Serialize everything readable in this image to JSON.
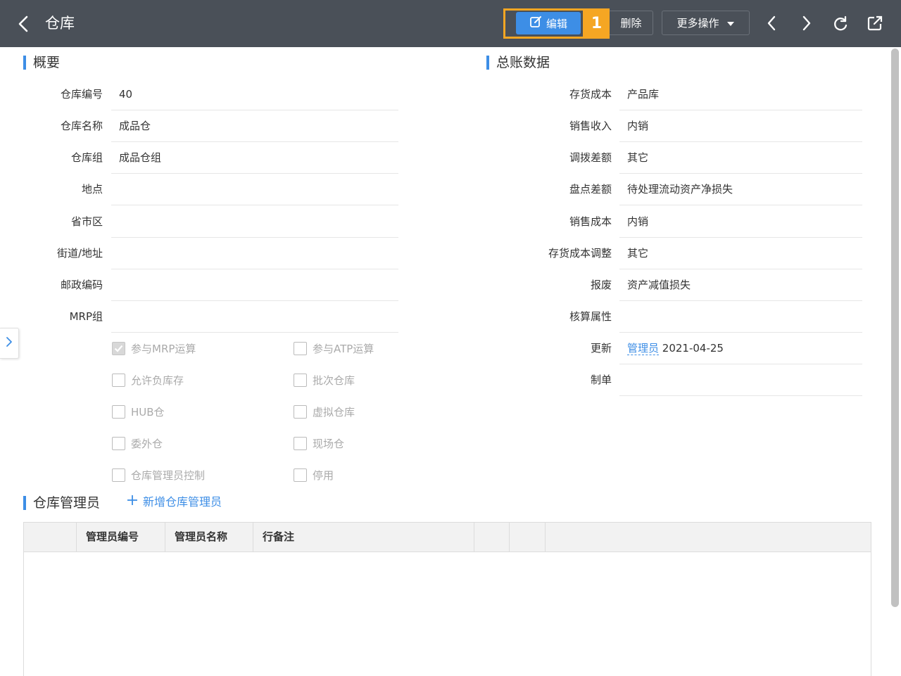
{
  "header": {
    "title": "仓库",
    "edit_label": "编辑",
    "marker": "1",
    "delete_label": "删除",
    "more_label": "更多操作"
  },
  "overview": {
    "title": "概要",
    "fields": [
      {
        "label": "仓库编号",
        "value": "40"
      },
      {
        "label": "仓库名称",
        "value": "成品仓"
      },
      {
        "label": "仓库组",
        "value": "成品仓组"
      },
      {
        "label": "地点",
        "value": ""
      },
      {
        "label": "省市区",
        "value": ""
      },
      {
        "label": "街道/地址",
        "value": ""
      },
      {
        "label": "邮政编码",
        "value": ""
      },
      {
        "label": "MRP组",
        "value": ""
      }
    ],
    "checkboxes": [
      {
        "label": "参与MRP运算",
        "checked": true
      },
      {
        "label": "参与ATP运算",
        "checked": false
      },
      {
        "label": "允许负库存",
        "checked": false
      },
      {
        "label": "批次仓库",
        "checked": false
      },
      {
        "label": "HUB仓",
        "checked": false
      },
      {
        "label": "虚拟仓库",
        "checked": false
      },
      {
        "label": "委外仓",
        "checked": false
      },
      {
        "label": "现场仓",
        "checked": false
      },
      {
        "label": "仓库管理员控制",
        "checked": false
      },
      {
        "label": "停用",
        "checked": false
      }
    ]
  },
  "ledger": {
    "title": "总账数据",
    "fields": [
      {
        "label": "存货成本",
        "value": "产品库"
      },
      {
        "label": "销售收入",
        "value": "内销"
      },
      {
        "label": "调拨差额",
        "value": "其它"
      },
      {
        "label": "盘点差额",
        "value": "待处理流动资产净损失"
      },
      {
        "label": "销售成本",
        "value": "内销"
      },
      {
        "label": "存货成本调整",
        "value": "其它"
      },
      {
        "label": "报废",
        "value": "资产减值损失"
      },
      {
        "label": "核算属性",
        "value": ""
      }
    ],
    "updated_label": "更新",
    "updated_by": "管理员",
    "updated_date": "2021-04-25",
    "created_label": "制单",
    "created_value": ""
  },
  "admins": {
    "title": "仓库管理员",
    "add_label": "新增仓库管理员",
    "columns": [
      "",
      "管理员编号",
      "管理员名称",
      "行备注",
      "",
      "",
      ""
    ]
  }
}
